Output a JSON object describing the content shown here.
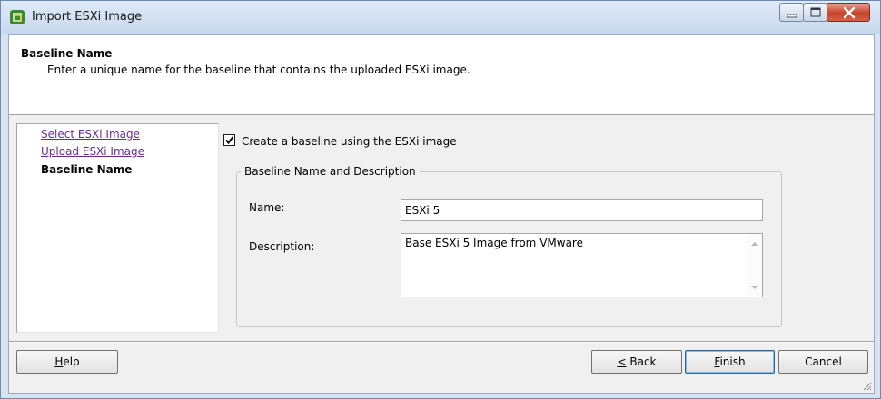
{
  "window": {
    "title": "Import ESXi Image",
    "icon": "vmware-app-icon"
  },
  "header": {
    "title": "Baseline Name",
    "description": "Enter a unique name for the baseline that contains the uploaded ESXi image."
  },
  "nav": {
    "items": [
      {
        "label": "Select ESXi Image",
        "state": "visited"
      },
      {
        "label": "Upload ESXi Image",
        "state": "visited"
      },
      {
        "label": "Baseline Name",
        "state": "current"
      }
    ]
  },
  "form": {
    "create_baseline": {
      "label": "Create a baseline using the ESXi image",
      "checked": true
    },
    "group_title": "Baseline Name and Description",
    "name": {
      "label": "Name:",
      "value": "ESXi 5"
    },
    "description": {
      "label": "Description:",
      "value": "Base ESXi 5 Image from VMware"
    }
  },
  "footer": {
    "help": {
      "mnemonic": "H",
      "rest": "elp"
    },
    "back": {
      "mnemonic": "<",
      "rest": " Back"
    },
    "finish": {
      "mnemonic": "F",
      "rest": "inish"
    },
    "cancel": "Cancel"
  },
  "colors": {
    "link_visited": "#6a2b94",
    "close_button": "#c7452a",
    "window_frame": "#d6e3f1"
  }
}
